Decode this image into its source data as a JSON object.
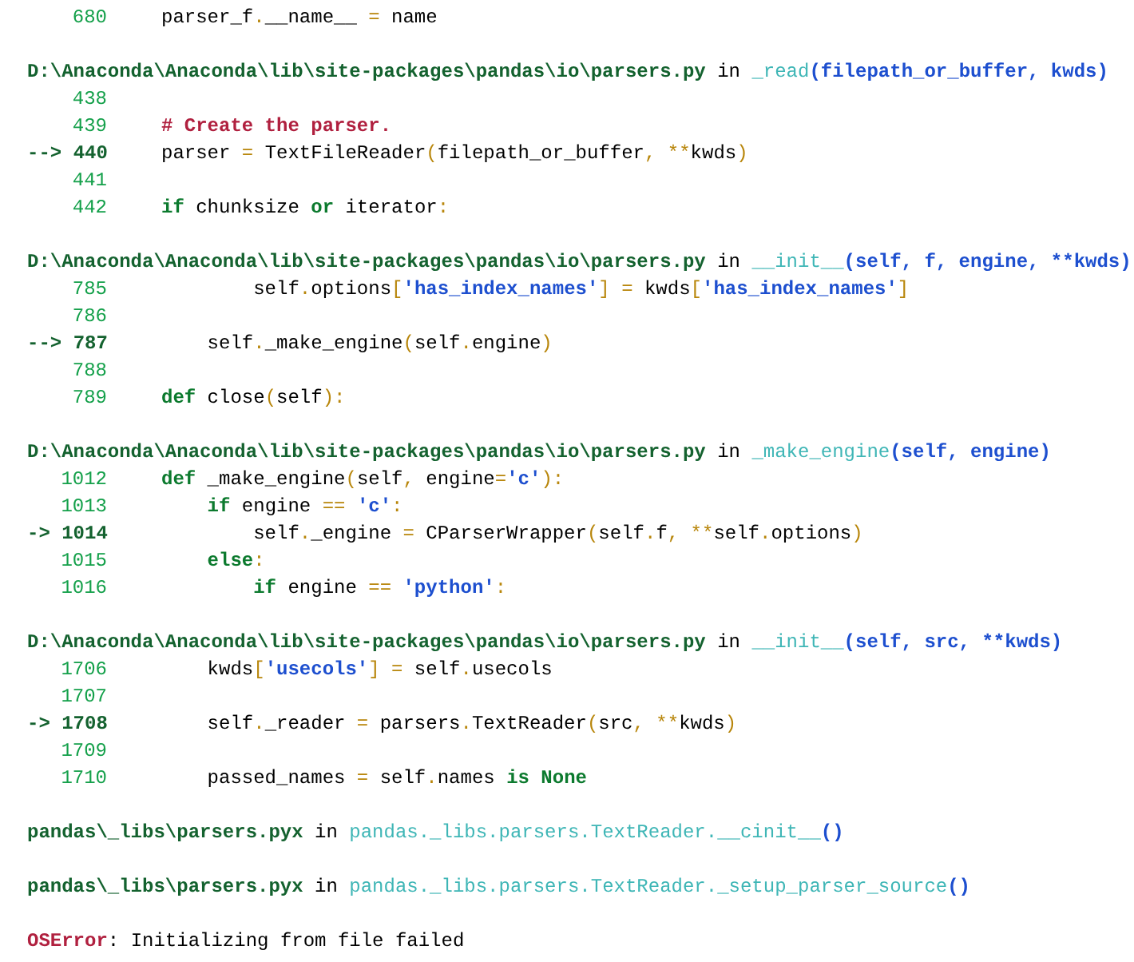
{
  "frames": [
    {
      "lines": [
        {
          "number": "680",
          "current": false,
          "tokens": [
            {
              "text": "parser_f",
              "kind": "plain"
            },
            {
              "text": ".",
              "kind": "op"
            },
            {
              "text": "__name__ ",
              "kind": "plain"
            },
            {
              "text": "=",
              "kind": "op"
            },
            {
              "text": " name",
              "kind": "plain"
            }
          ]
        }
      ]
    },
    {
      "header": {
        "file": "D:\\Anaconda\\Anaconda\\lib\\site-packages\\pandas\\io\\parsers.py",
        "in": "in",
        "func": "_read",
        "args": "(filepath_or_buffer, kwds)"
      },
      "lines": [
        {
          "number": "438",
          "current": false
        },
        {
          "number": "439",
          "current": false,
          "tokens": [
            {
              "text": "# Create the parser.",
              "kind": "comment"
            }
          ]
        },
        {
          "number": "440",
          "current": true,
          "arrow": "-->",
          "tokens": [
            {
              "text": "parser ",
              "kind": "plain"
            },
            {
              "text": "=",
              "kind": "op"
            },
            {
              "text": " TextFileReader",
              "kind": "plain"
            },
            {
              "text": "(",
              "kind": "op"
            },
            {
              "text": "filepath_or_buffer",
              "kind": "plain"
            },
            {
              "text": ", ",
              "kind": "op"
            },
            {
              "text": "**",
              "kind": "op"
            },
            {
              "text": "kwds",
              "kind": "plain"
            },
            {
              "text": ")",
              "kind": "op"
            }
          ]
        },
        {
          "number": "441",
          "current": false
        },
        {
          "number": "442",
          "current": false,
          "tokens": [
            {
              "text": "if",
              "kind": "kw"
            },
            {
              "text": " chunksize ",
              "kind": "plain"
            },
            {
              "text": "or",
              "kind": "kw"
            },
            {
              "text": " iterator",
              "kind": "plain"
            },
            {
              "text": ":",
              "kind": "op"
            }
          ]
        }
      ]
    },
    {
      "header": {
        "file": "D:\\Anaconda\\Anaconda\\lib\\site-packages\\pandas\\io\\parsers.py",
        "in": "in",
        "func": "__init__",
        "args": "(self, f, engine, **kwds)"
      },
      "lines": [
        {
          "number": "785",
          "current": false,
          "tokens": [
            {
              "text": "        self",
              "kind": "plain"
            },
            {
              "text": ".",
              "kind": "op"
            },
            {
              "text": "options",
              "kind": "plain"
            },
            {
              "text": "[",
              "kind": "op"
            },
            {
              "text": "'has_index_names'",
              "kind": "str"
            },
            {
              "text": "]",
              "kind": "op"
            },
            {
              "text": " =",
              "kind": "op"
            },
            {
              "text": " kwds",
              "kind": "plain"
            },
            {
              "text": "[",
              "kind": "op"
            },
            {
              "text": "'has_index_names'",
              "kind": "str"
            },
            {
              "text": "]",
              "kind": "op"
            }
          ]
        },
        {
          "number": "786",
          "current": false
        },
        {
          "number": "787",
          "current": true,
          "arrow": "-->",
          "tokens": [
            {
              "text": "    self",
              "kind": "plain"
            },
            {
              "text": ".",
              "kind": "op"
            },
            {
              "text": "_make_engine",
              "kind": "plain"
            },
            {
              "text": "(",
              "kind": "op"
            },
            {
              "text": "self",
              "kind": "plain"
            },
            {
              "text": ".",
              "kind": "op"
            },
            {
              "text": "engine",
              "kind": "plain"
            },
            {
              "text": ")",
              "kind": "op"
            }
          ]
        },
        {
          "number": "788",
          "current": false
        },
        {
          "number": "789",
          "current": false,
          "tokens": [
            {
              "text": "def",
              "kind": "kw"
            },
            {
              "text": " close",
              "kind": "plain"
            },
            {
              "text": "(",
              "kind": "op"
            },
            {
              "text": "self",
              "kind": "plain"
            },
            {
              "text": ")",
              "kind": "op"
            },
            {
              "text": ":",
              "kind": "op"
            }
          ]
        }
      ]
    },
    {
      "header": {
        "file": "D:\\Anaconda\\Anaconda\\lib\\site-packages\\pandas\\io\\parsers.py",
        "in": "in",
        "func": "_make_engine",
        "args": "(self, engine)"
      },
      "lines": [
        {
          "number": "1012",
          "current": false,
          "tokens": [
            {
              "text": "def",
              "kind": "kw"
            },
            {
              "text": " _make_engine",
              "kind": "plain"
            },
            {
              "text": "(",
              "kind": "op"
            },
            {
              "text": "self",
              "kind": "plain"
            },
            {
              "text": ",",
              "kind": "op"
            },
            {
              "text": " engine",
              "kind": "plain"
            },
            {
              "text": "=",
              "kind": "op"
            },
            {
              "text": "'c'",
              "kind": "str"
            },
            {
              "text": ")",
              "kind": "op"
            },
            {
              "text": ":",
              "kind": "op"
            }
          ]
        },
        {
          "number": "1013",
          "current": false,
          "tokens": [
            {
              "text": "    if",
              "kind": "kw"
            },
            {
              "text": " engine ",
              "kind": "plain"
            },
            {
              "text": "== ",
              "kind": "op"
            },
            {
              "text": "'c'",
              "kind": "str"
            },
            {
              "text": ":",
              "kind": "op"
            }
          ]
        },
        {
          "number": "1014",
          "current": true,
          "arrow": "->",
          "tokens": [
            {
              "text": "        self",
              "kind": "plain"
            },
            {
              "text": ".",
              "kind": "op"
            },
            {
              "text": "_engine ",
              "kind": "plain"
            },
            {
              "text": "=",
              "kind": "op"
            },
            {
              "text": " CParserWrapper",
              "kind": "plain"
            },
            {
              "text": "(",
              "kind": "op"
            },
            {
              "text": "self",
              "kind": "plain"
            },
            {
              "text": ".",
              "kind": "op"
            },
            {
              "text": "f",
              "kind": "plain"
            },
            {
              "text": ", ",
              "kind": "op"
            },
            {
              "text": "**",
              "kind": "op"
            },
            {
              "text": "self",
              "kind": "plain"
            },
            {
              "text": ".",
              "kind": "op"
            },
            {
              "text": "options",
              "kind": "plain"
            },
            {
              "text": ")",
              "kind": "op"
            }
          ]
        },
        {
          "number": "1015",
          "current": false,
          "tokens": [
            {
              "text": "    else",
              "kind": "kw"
            },
            {
              "text": ":",
              "kind": "op"
            }
          ]
        },
        {
          "number": "1016",
          "current": false,
          "tokens": [
            {
              "text": "        if",
              "kind": "kw"
            },
            {
              "text": " engine ",
              "kind": "plain"
            },
            {
              "text": "== ",
              "kind": "op"
            },
            {
              "text": "'python'",
              "kind": "str"
            },
            {
              "text": ":",
              "kind": "op"
            }
          ]
        }
      ]
    },
    {
      "header": {
        "file": "D:\\Anaconda\\Anaconda\\lib\\site-packages\\pandas\\io\\parsers.py",
        "in": "in",
        "func": "__init__",
        "args": "(self, src, **kwds)"
      },
      "lines": [
        {
          "number": "1706",
          "current": false,
          "tokens": [
            {
              "text": "    kwds",
              "kind": "plain"
            },
            {
              "text": "[",
              "kind": "op"
            },
            {
              "text": "'usecols'",
              "kind": "str"
            },
            {
              "text": "]",
              "kind": "op"
            },
            {
              "text": " =",
              "kind": "op"
            },
            {
              "text": " self",
              "kind": "plain"
            },
            {
              "text": ".",
              "kind": "op"
            },
            {
              "text": "usecols",
              "kind": "plain"
            }
          ]
        },
        {
          "number": "1707",
          "current": false
        },
        {
          "number": "1708",
          "current": true,
          "arrow": "->",
          "tokens": [
            {
              "text": "    self",
              "kind": "plain"
            },
            {
              "text": ".",
              "kind": "op"
            },
            {
              "text": "_reader ",
              "kind": "plain"
            },
            {
              "text": "=",
              "kind": "op"
            },
            {
              "text": " parsers",
              "kind": "plain"
            },
            {
              "text": ".",
              "kind": "op"
            },
            {
              "text": "TextReader",
              "kind": "plain"
            },
            {
              "text": "(",
              "kind": "op"
            },
            {
              "text": "src",
              "kind": "plain"
            },
            {
              "text": ", ",
              "kind": "op"
            },
            {
              "text": "**",
              "kind": "op"
            },
            {
              "text": "kwds",
              "kind": "plain"
            },
            {
              "text": ")",
              "kind": "op"
            }
          ]
        },
        {
          "number": "1709",
          "current": false
        },
        {
          "number": "1710",
          "current": false,
          "tokens": [
            {
              "text": "    passed_names ",
              "kind": "plain"
            },
            {
              "text": "=",
              "kind": "op"
            },
            {
              "text": " self",
              "kind": "plain"
            },
            {
              "text": ".",
              "kind": "op"
            },
            {
              "text": "names ",
              "kind": "plain"
            },
            {
              "text": "is",
              "kind": "kw"
            },
            {
              "text": " None",
              "kind": "kw"
            }
          ]
        }
      ]
    },
    {
      "header": {
        "file": "pandas\\_libs\\parsers.pyx",
        "in": "in",
        "func": "pandas._libs.parsers.TextReader.__cinit__",
        "args": "()"
      }
    },
    {
      "header": {
        "file": "pandas\\_libs\\parsers.pyx",
        "in": "in",
        "func": "pandas._libs.parsers.TextReader._setup_parser_source",
        "args": "()"
      }
    }
  ],
  "error": {
    "type": "OSError",
    "message": ": Initializing from file failed"
  }
}
